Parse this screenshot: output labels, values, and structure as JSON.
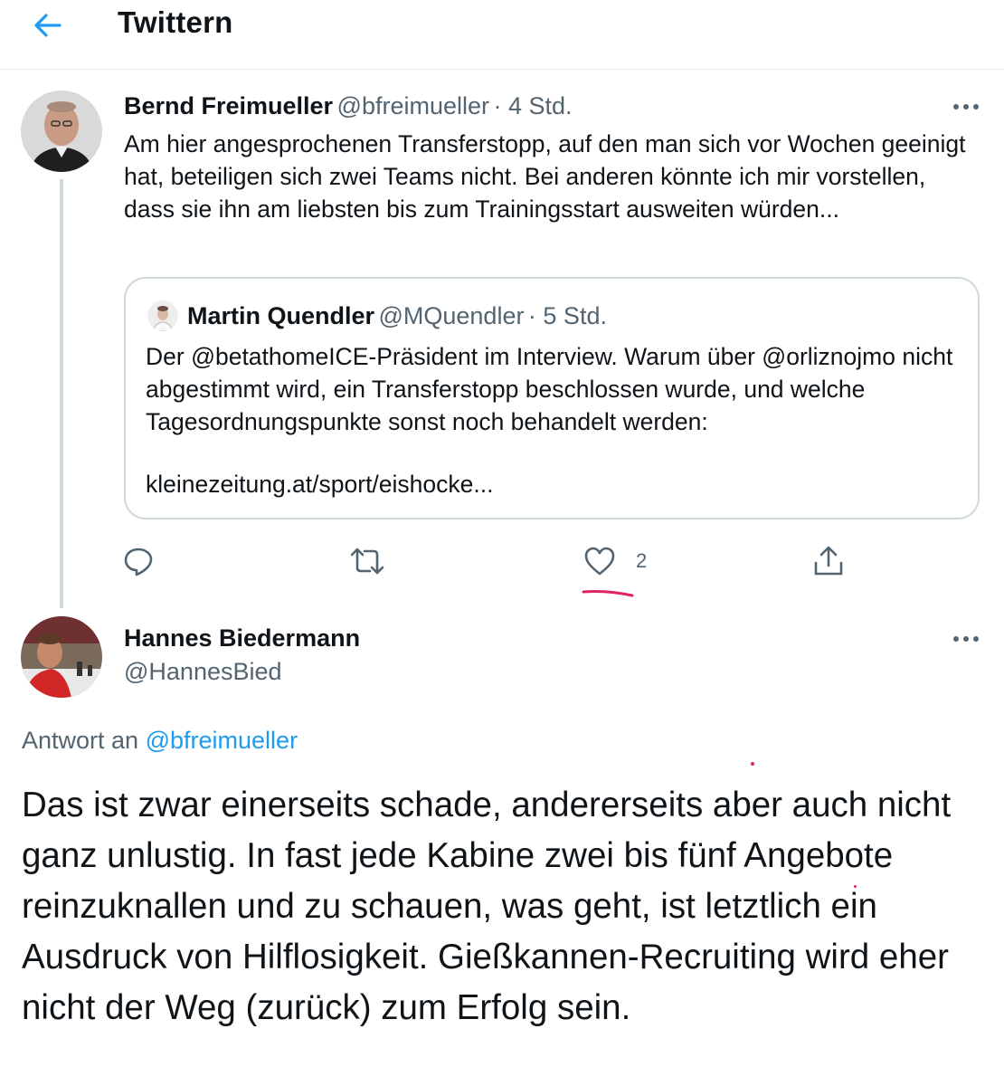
{
  "header": {
    "title": "Twittern",
    "back_icon": "arrow-left-icon",
    "accent": "#1d9bf0"
  },
  "tweet_main": {
    "name": "Bernd Freimueller",
    "handle": "@bfreimueller",
    "time": "· 4 Std.",
    "text": "Am hier angesprochenen Transferstopp, auf den man sich vor Wochen geeinigt hat, beteiligen sich zwei Teams nicht. Bei anderen könnte ich mir vorstellen, dass sie ihn am liebsten bis zum Trainingsstart ausweiten würden...",
    "quote": {
      "name": "Martin Quendler",
      "handle": "@MQuendler",
      "time": "· 5 Std.",
      "text": "Der @betathomeICE-Präsident im Interview. Warum über @orliznojmo nicht abgestimmt wird, ein Transferstopp beschlossen wurde, und welche Tagesordnungspunkte sonst noch behandelt werden:",
      "link": "kleinezeitung.at/sport/eishocke..."
    },
    "actions": {
      "like_count": "2"
    }
  },
  "tweet_reply": {
    "name": "Hannes Biedermann",
    "handle": "@HannesBied",
    "reply_prefix": "Antwort an",
    "reply_to": "@bfreimueller",
    "text": "Das ist zwar einerseits schade, andererseits aber auch nicht ganz unlustig. In fast jede Kabine zwei bis fünf Angebote reinzuknallen und zu schauen, was geht, ist letztlich ein Ausdruck von Hilflosigkeit. Gießkannen-Recruiting wird eher nicht der Weg (zurück) zum Erfolg sein."
  },
  "colors": {
    "text": "#0f1419",
    "secondary": "#536471",
    "link": "#1d9bf0",
    "border": "#cfd9de",
    "annotation_red": "#e0245e"
  }
}
